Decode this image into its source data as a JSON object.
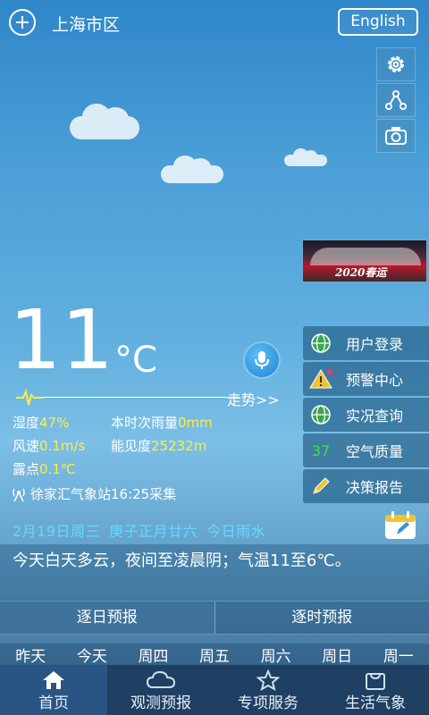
{
  "header": {
    "city": "上海市区",
    "language_button": "English",
    "add_icon": "plus-circle-icon"
  },
  "toolbar": {
    "icons": [
      "gear-icon",
      "share-icon",
      "camera-icon"
    ]
  },
  "banner": {
    "text": "2020春运"
  },
  "weather": {
    "temperature": "11",
    "unit": "°C",
    "trend_link": "走势>>",
    "humidity": {
      "label": "湿度",
      "value": "47%"
    },
    "rainfall": {
      "label": "本时次雨量",
      "value": "0mm"
    },
    "wind": {
      "label": "风速",
      "value": "0.1m/s"
    },
    "visibility": {
      "label": "能见度",
      "value": "25232m"
    },
    "dewpoint": {
      "label": "露点",
      "value": "0.1℃"
    },
    "station": "徐家汇气象站16:25采集"
  },
  "side_menu": [
    {
      "label": "用户登录",
      "icon": "globe-icon"
    },
    {
      "label": "预警中心",
      "icon": "warning-icon"
    },
    {
      "label": "实况查询",
      "icon": "globe-icon"
    },
    {
      "label": "空气质量",
      "aqi": "37"
    },
    {
      "label": "决策报告",
      "icon": "pencil-icon"
    }
  ],
  "date_info": {
    "date": "2月19日周三",
    "lunar": "庚子正月廿六",
    "solar_term": "今日雨水"
  },
  "summary": "今天白天多云，夜间至凌晨阴；气温11至6℃。",
  "forecast_tabs": [
    "逐日预报",
    "逐时预报"
  ],
  "days": [
    "昨天",
    "今天",
    "周四",
    "周五",
    "周六",
    "周日",
    "周一"
  ],
  "bottom_nav": [
    {
      "label": "首页",
      "icon": "home-icon"
    },
    {
      "label": "观测预报",
      "icon": "cloud-icon"
    },
    {
      "label": "专项服务",
      "icon": "star-icon"
    },
    {
      "label": "生活气象",
      "icon": "bag-icon"
    }
  ],
  "colors": {
    "highlight_yellow": "#ffee44",
    "date_cyan": "#67d8ff",
    "aqi_green": "#36e05a",
    "nav_bg": "#1f3f63"
  }
}
